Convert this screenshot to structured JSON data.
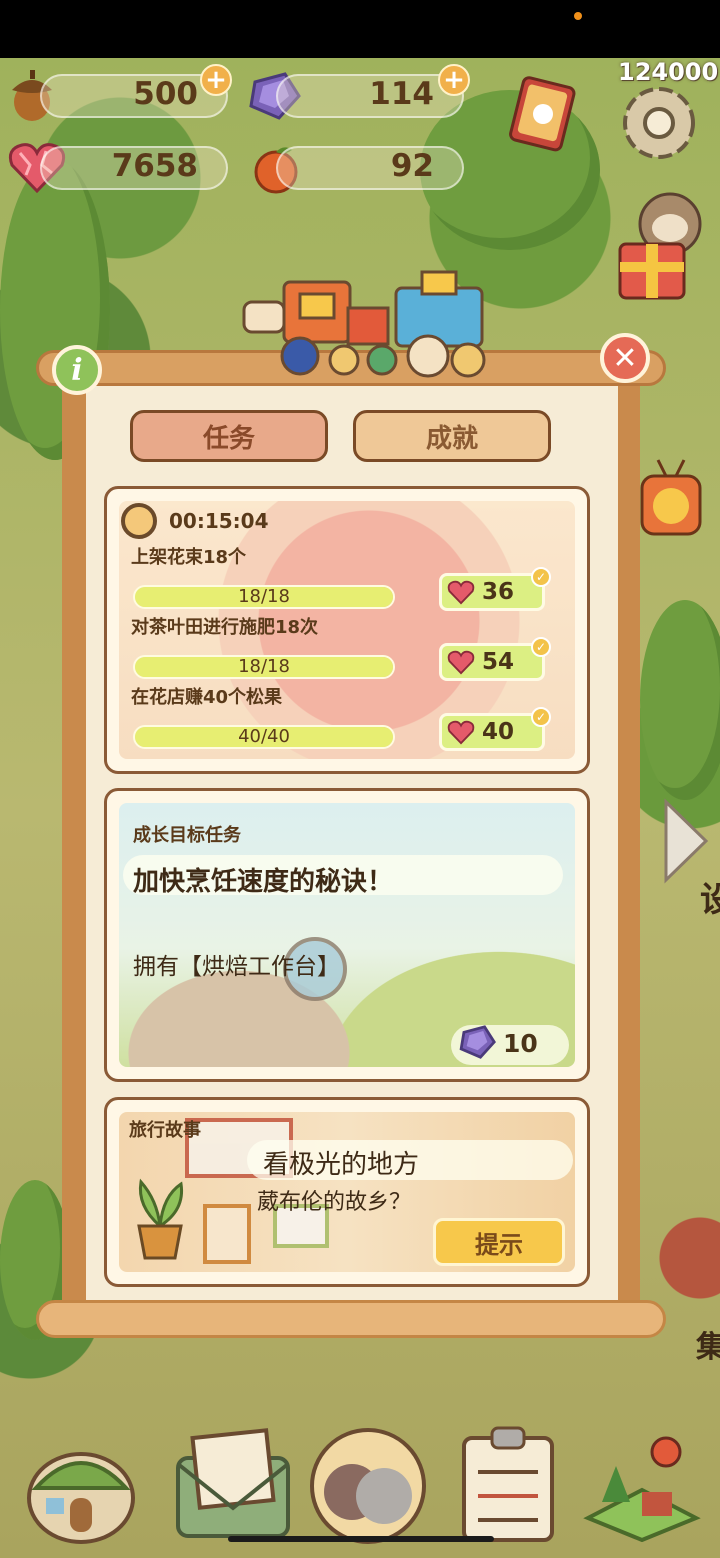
{
  "status_bar": {
    "score": "124000"
  },
  "hud": {
    "acorns": "500",
    "gems": "114",
    "hearts": "7658",
    "fruits": "92"
  },
  "tabs": [
    {
      "label": "任务",
      "active": true
    },
    {
      "label": "成就",
      "active": false
    }
  ],
  "daily_tasks": {
    "timer": "00:15:04",
    "items": [
      {
        "label": "上架花束18个",
        "progress": "18/18",
        "fraction": 1.0,
        "reward": "36"
      },
      {
        "label": "对茶叶田进行施肥18次",
        "progress": "18/18",
        "fraction": 1.0,
        "reward": "54"
      },
      {
        "label": "在花店赚40个松果",
        "progress": "40/40",
        "fraction": 1.0,
        "reward": "40"
      }
    ]
  },
  "growth_task": {
    "section_label": "成长目标任务",
    "title": "加快烹饪速度的秘诀！",
    "description": "拥有【烘焙工作台】",
    "reward": "10"
  },
  "travel_story": {
    "section_label": "旅行故事",
    "title": "看极光的地方",
    "subtitle": "葳布伦的故乡？",
    "hint_label": "提示"
  },
  "right_edge_text": {
    "a": "设",
    "b": "集"
  },
  "colors": {
    "panel": "#f6ecd6",
    "wood": "#c98a4c",
    "bar": "#e7ee72",
    "reward": "#dcef83",
    "hint": "#f7c84b",
    "close": "#e56a56",
    "info": "#8fc25a"
  }
}
